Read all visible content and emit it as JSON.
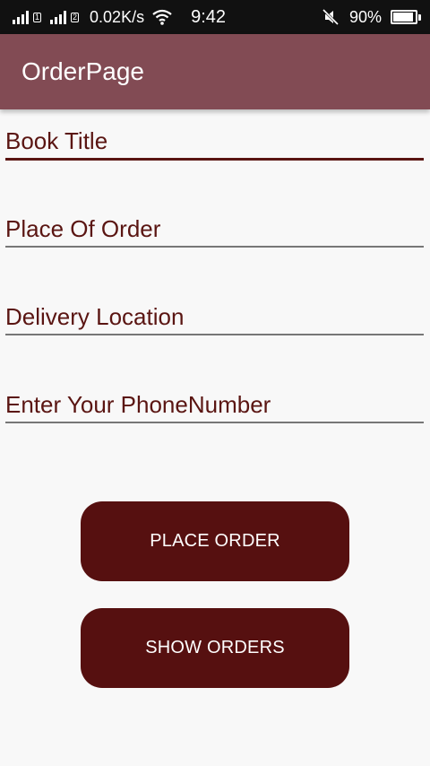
{
  "status_bar": {
    "speed": "0.02K/s",
    "time": "9:42",
    "battery": "90%",
    "sim1": "1",
    "sim2": "2",
    "battery_level": 0.9,
    "icons": [
      "signal-icon",
      "signal-icon",
      "wifi-icon",
      "mute-icon",
      "battery-icon"
    ]
  },
  "app_bar": {
    "title": "OrderPage"
  },
  "form": {
    "fields": [
      {
        "placeholder": "Book Title",
        "focused": true
      },
      {
        "placeholder": "Place Of Order",
        "focused": false
      },
      {
        "placeholder": "Delivery Location",
        "focused": false
      },
      {
        "placeholder": "Enter Your PhoneNumber",
        "focused": false
      }
    ]
  },
  "buttons": {
    "place_order": "PLACE ORDER",
    "show_orders": "SHOW ORDERS"
  },
  "colors": {
    "app_bar": "#824b54",
    "accent": "#5a1512",
    "button": "#561010",
    "background": "#f8f8f8"
  }
}
